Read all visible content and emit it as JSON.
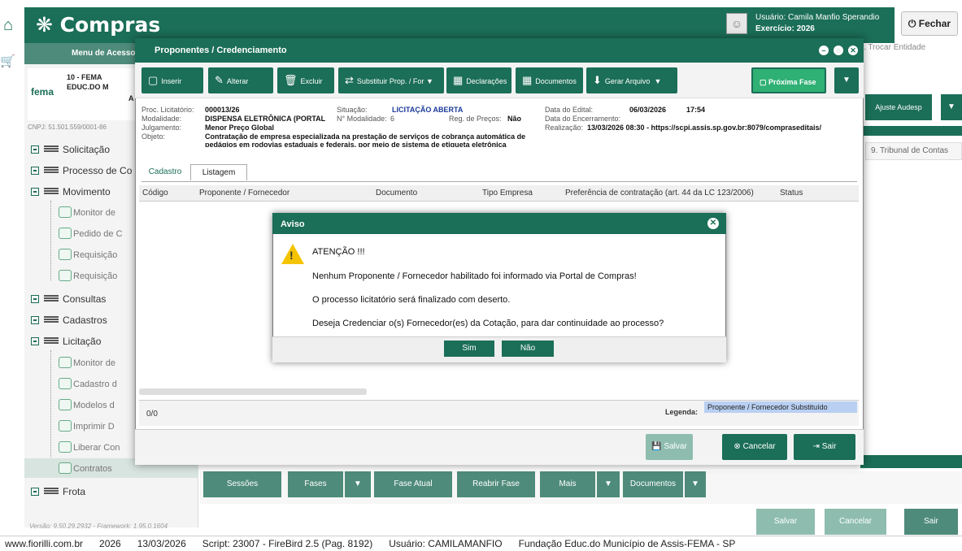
{
  "header": {
    "app_title": "Compras",
    "user_label": "Usuário: Camila Manfio Sperandio",
    "exercise_label": "Exercício: 2026",
    "close_label": "Fechar"
  },
  "sidebar": {
    "header_label": "Menu de Acesso",
    "org_code": "10 - FEMA",
    "org_name": "EDUC.DO M",
    "org_suffix": "A",
    "org_logo": "fema",
    "cnpj": "CNPJ: 51.501.559/0001-86",
    "groups": [
      {
        "label": "Solicitação"
      },
      {
        "label": "Processo de Co"
      },
      {
        "label": "Movimento"
      },
      {
        "label": "Consultas"
      },
      {
        "label": "Cadastros"
      },
      {
        "label": "Licitação"
      },
      {
        "label": "Frota"
      }
    ],
    "movimento_items": [
      "Monitor de",
      "Pedido de C",
      "Requisição",
      "Requisição"
    ],
    "licitacao_items": [
      "Monitor de",
      "Cadastro d",
      "Modelos d",
      "Imprimir D",
      "Liberar Con",
      "Contratos"
    ],
    "version": "Versão: 9.50.29.2932 - Framework: 1.95.0.1604"
  },
  "right_panel": {
    "trocar": "Trocar Entidade",
    "ajuste": "Ajuste Audesp",
    "tribunal": "9. Tribunal de Contas"
  },
  "bottom_bar": {
    "buttons": [
      "Sessões",
      "Fases",
      "Fase Atual",
      "Reabrir Fase",
      "Mais",
      "Documentos"
    ],
    "actions": [
      "Salvar",
      "Cancelar",
      "Sair"
    ]
  },
  "modal": {
    "title": "Proponentes / Credenciamento",
    "toolbar": [
      "Inserir",
      "Alterar",
      "Excluir",
      "Substituir Prop. / For",
      "Declarações",
      "Documentos",
      "Gerar Arquivo"
    ],
    "next_phase": "Próxima Fase",
    "info": {
      "proc_label": "Proc. Licitatório:",
      "proc_value": "000013/26",
      "situacao_label": "Situação:",
      "situacao_value": "LICITAÇÃO ABERTA",
      "data_edital_label": "Data do Edital:",
      "data_edital_value": "06/03/2026",
      "hora_edital": "17:54",
      "modalidade_label": "Modalidade:",
      "modalidade_value": "DISPENSA ELETRÔNICA (PORTAL",
      "nmod_label": "N° Modalidade:",
      "nmod_value": "6",
      "reg_label": "Reg. de Preços:",
      "reg_value": "Não",
      "encerramento_label": "Data do Encerramento:",
      "julgamento_label": "Julgamento:",
      "julgamento_value": "Menor Preço Global",
      "realizacao_label": "Realização:",
      "realizacao_value": "13/03/2026 08:30 - https://scpi.assis.sp.gov.br:8079/compraseditais/",
      "objeto_label": "Objeto:",
      "objeto_value": "Contratação de empresa especializada na prestação de serviços de cobrança automática de",
      "objeto_value2": "pedágios em rodovias estaduais e federais, por meio de sistema de etiqueta eletrônica"
    },
    "tabs": [
      "Cadastro",
      "Listagem"
    ],
    "columns": [
      "Código",
      "Proponente / Fornecedor",
      "Documento",
      "Tipo Empresa",
      "Preferência de contratação (art. 44 da LC 123/2006)",
      "Status"
    ],
    "record_count": "0/0",
    "legend_label": "Legenda:",
    "legend_value": "Proponente / Fornecedor Substituído",
    "actions": [
      "Salvar",
      "Cancelar",
      "Sair"
    ]
  },
  "dialog": {
    "title": "Aviso",
    "heading": "ATENÇÃO !!!",
    "line1": "Nenhum Proponente / Fornecedor habilitado foi informado via Portal de Compras!",
    "line2": "O processo licitatório será finalizado com deserto.",
    "line3": "Deseja Credenciar o(s) Fornecedor(es) da Cotação, para dar continuidade ao processo?",
    "yes": "Sim",
    "no": "Não"
  },
  "statusbar": {
    "site": "www.fiorilli.com.br",
    "year": "2026",
    "date": "13/03/2026",
    "script": "Script: 23007 - FireBird 2.5 (Pag. 8192)",
    "user": "Usuário: CAMILAMANFIO",
    "entity": "Fundação Educ.do Município de Assis-FEMA - SP"
  },
  "colors": {
    "primary": "#1b6e57",
    "next_phase": "#2fb074",
    "warning": "#f5c400"
  }
}
